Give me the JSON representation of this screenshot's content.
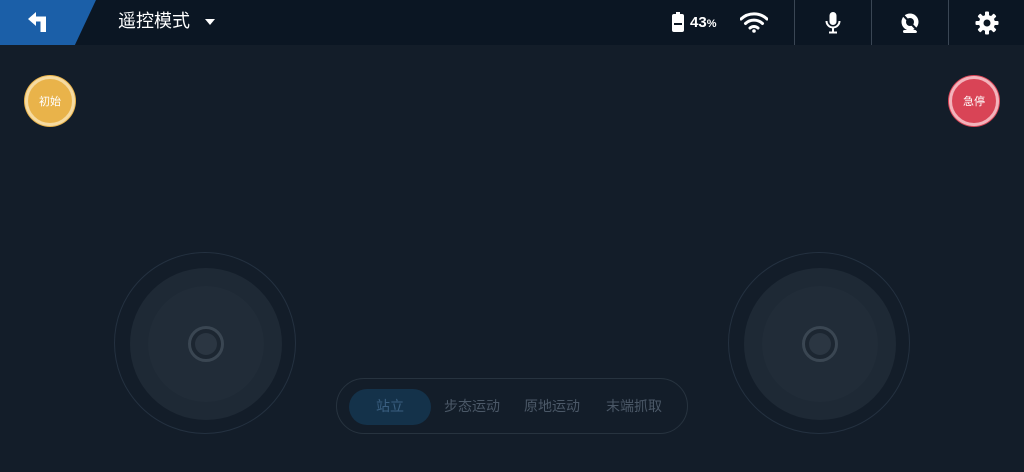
{
  "header": {
    "mode_title": "遥控模式",
    "battery_value": "43",
    "battery_unit": "%"
  },
  "icons": {
    "back": "back-arrow-icon",
    "dropdown": "caret-down-icon",
    "battery": "battery-icon",
    "wifi": "wifi-icon",
    "microphone": "microphone-icon",
    "camera": "camera-icon",
    "settings": "gear-icon"
  },
  "buttons": {
    "init_label": "初始",
    "emergency_stop_label": "急停"
  },
  "mode_tabs": [
    {
      "label": "站立",
      "active": true
    },
    {
      "label": "步态运动",
      "active": false
    },
    {
      "label": "原地运动",
      "active": false
    },
    {
      "label": "末端抓取",
      "active": false
    }
  ],
  "colors": {
    "background": "#131d29",
    "topbar": "#0b1623",
    "back_button": "#1b5fa8",
    "init_button": "#e9b34a",
    "stop_button": "#d94456",
    "active_tab": "#14324a"
  }
}
